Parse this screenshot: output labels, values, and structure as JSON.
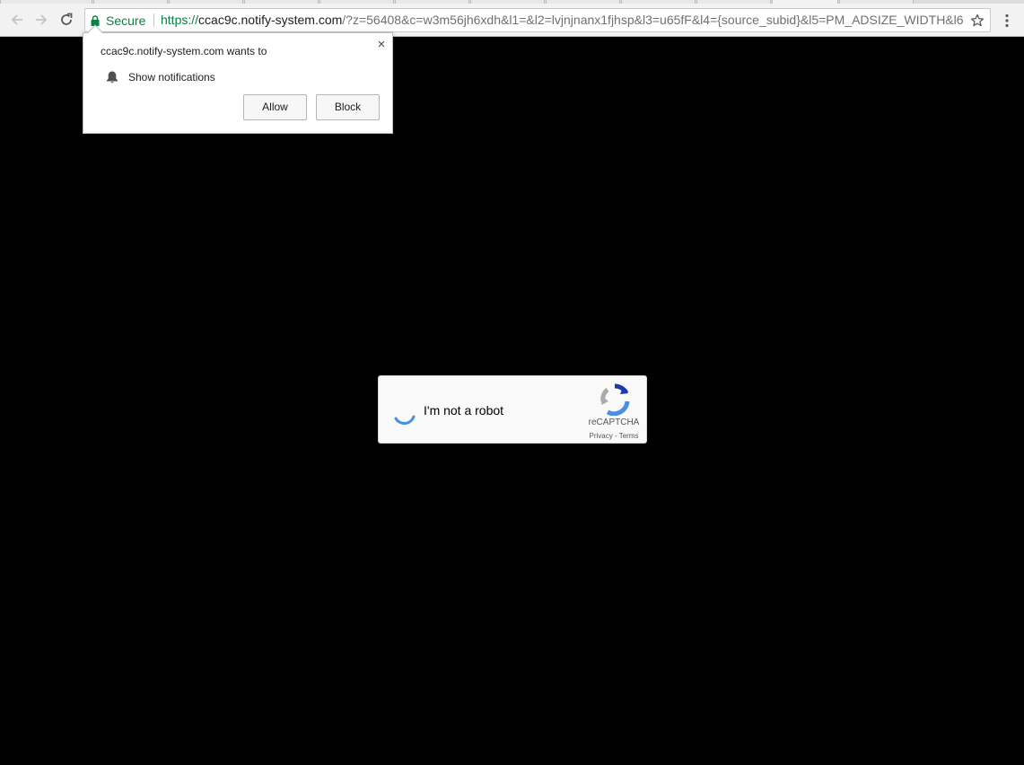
{
  "browser": {
    "security_label": "Secure",
    "url": {
      "scheme": "https://",
      "host": "ccac9c.notify-system.com",
      "rest": "/?z=56408&c=w3m56jh6xdh&l1=&l2=lvjnjnanx1fjhsp&l3=u65fF&l4={source_subid}&l5=PM_ADSIZE_WIDTH&l6"
    },
    "icons": [
      "back-arrow-icon",
      "forward-arrow-icon",
      "reload-icon",
      "lock-icon",
      "star-icon",
      "menu-dots-icon"
    ]
  },
  "permission_prompt": {
    "title": "ccac9c.notify-system.com wants to",
    "permission": "Show notifications",
    "close_symbol": "×",
    "allow_label": "Allow",
    "block_label": "Block"
  },
  "recaptcha": {
    "label": "I'm not a robot",
    "brand": "reCAPTCHA",
    "links": "Privacy - Terms"
  },
  "colors": {
    "page_background": "#000000",
    "secure_green": "#0b8043",
    "recaptcha_blue": "#4a90e2"
  }
}
